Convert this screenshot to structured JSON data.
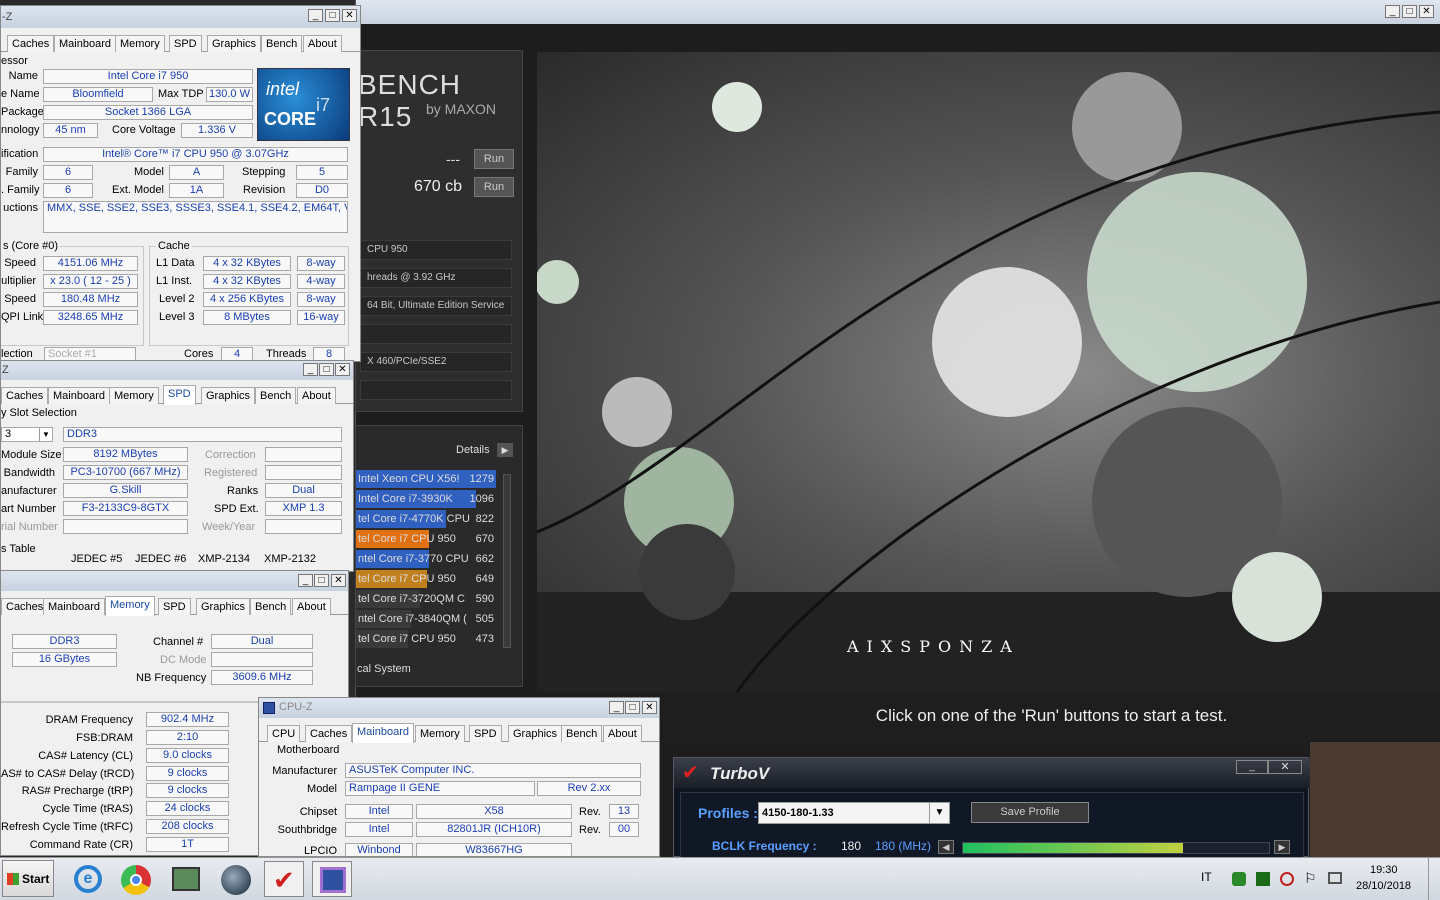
{
  "cinebench": {
    "title_main": "BENCH R15",
    "title_sub": "by MAXON",
    "opengl_score": "---",
    "cpu_score": "670 cb",
    "run_label": "Run",
    "processor": "CPU 950",
    "cores": "hreads @ 3.92 GHz",
    "os": "64 Bit, Ultimate Edition Service",
    "gfx": "X 460/PCIe/SSE2",
    "details_label": "Details",
    "status": "Click on one of the 'Run' buttons to start a test.",
    "local_system": "cal System",
    "aixsponza": "AIXSPONZA",
    "ranking": [
      {
        "name": "Intel Xeon CPU X56!",
        "score": "1279",
        "color": "#3060c0",
        "fill": 1.0
      },
      {
        "name": "Intel Core i7-3930K",
        "score": "1096",
        "color": "#3060c0",
        "fill": 0.857
      },
      {
        "name": "tel Core i7-4770K CPU",
        "score": "822",
        "color": "#3060c0",
        "fill": 0.643
      },
      {
        "name": "tel Core i7 CPU 950",
        "score": "670",
        "color": "#e07010",
        "fill": 0.524
      },
      {
        "name": "ntel Core i7-3770 CPU",
        "score": "662",
        "color": "#3060c0",
        "fill": 0.518
      },
      {
        "name": "tel Core i7 CPU 950",
        "score": "649",
        "color": "#c08020",
        "fill": 0.507
      },
      {
        "name": "tel Core i7-3720QM C",
        "score": "590",
        "color": "#3a3a3a",
        "fill": 0.46
      },
      {
        "name": "ntel Core i7-3840QM (",
        "score": "505",
        "color": "#3a3a3a",
        "fill": 0.395
      },
      {
        "name": "tel Core i7 CPU 950",
        "score": "473",
        "color": "#3a3a3a",
        "fill": 0.37
      }
    ]
  },
  "cpuz_cpu": {
    "title": "-Z",
    "tabs": [
      "Caches",
      "Mainboard",
      "Memory",
      "SPD",
      "Graphics",
      "Bench",
      "About"
    ],
    "group": "essor",
    "name_lbl": "Name",
    "name": "Intel Core i7 950",
    "code_lbl": "e Name",
    "code": "Bloomfield",
    "tdp_lbl": "Max TDP",
    "tdp": "130.0 W",
    "pkg_lbl": "Package",
    "pkg": "Socket 1366 LGA",
    "tech_lbl": "nnology",
    "tech": "45 nm",
    "volt_lbl": "Core Voltage",
    "volt": "1.336 V",
    "spec_lbl": "ification",
    "spec": "Intel® Core™ i7 CPU        950  @ 3.07GHz",
    "fam_lbl": "Family",
    "fam": "6",
    "model_lbl": "Model",
    "model": "A",
    "step_lbl": "Stepping",
    "step": "5",
    "efam_lbl": ". Family",
    "efam": "6",
    "emodel_lbl": "Ext. Model",
    "emodel": "1A",
    "rev_lbl": "Revision",
    "rev": "D0",
    "instr_lbl": "uctions",
    "instr": "MMX, SSE, SSE2, SSE3, SSSE3, SSE4.1, SSE4.2, EM64T, VT-x",
    "clocks_grp": "s (Core #0)",
    "cspeed_lbl": "Speed",
    "cspeed": "4151.06 MHz",
    "mult_lbl": "ultiplier",
    "mult": "x 23.0 ( 12 - 25 )",
    "bspeed_lbl": "Speed",
    "bspeed": "180.48 MHz",
    "qpi_lbl": "QPI Link",
    "qpi": "3248.65 MHz",
    "cache_grp": "Cache",
    "l1d_lbl": "L1 Data",
    "l1d": "4 x 32 KBytes",
    "l1d_w": "8-way",
    "l1i_lbl": "L1 Inst.",
    "l1i": "4 x 32 KBytes",
    "l1i_w": "4-way",
    "l2_lbl": "Level 2",
    "l2": "4 x 256 KBytes",
    "l2_w": "8-way",
    "l3_lbl": "Level 3",
    "l3": "8 MBytes",
    "l3_w": "16-way",
    "sel_lbl": "lection",
    "sel": "Socket #1",
    "cores_lbl": "Cores",
    "cores": "4",
    "threads_lbl": "Threads",
    "threads": "8"
  },
  "cpuz_spd": {
    "title": "Z",
    "tabs": [
      "Caches",
      "Mainboard",
      "Memory",
      "SPD",
      "Graphics",
      "Bench",
      "About"
    ],
    "slot_grp": "y Slot Selection",
    "slot": "3",
    "type": "DDR3",
    "msize_lbl": "Module Size",
    "msize": "8192 MBytes",
    "corr_lbl": "Correction",
    "bw_lbl": "Bandwidth",
    "bw": "PC3-10700 (667 MHz)",
    "reg_lbl": "Registered",
    "manu_lbl": "anufacturer",
    "manu": "G.Skill",
    "ranks_lbl": "Ranks",
    "ranks": "Dual",
    "part_lbl": "art Number",
    "part": "F3-2133C9-8GTX",
    "spdext_lbl": "SPD Ext.",
    "spdext": "XMP 1.3",
    "serial_lbl": "rial Number",
    "week_lbl": "Week/Year",
    "timings_grp": "s Table",
    "t_cols": [
      "JEDEC #5",
      "JEDEC #6",
      "XMP-2134",
      "XMP-2132"
    ]
  },
  "cpuz_mem": {
    "tabs": [
      "Caches",
      "Mainboard",
      "Memory",
      "SPD",
      "Graphics",
      "Bench",
      "About"
    ],
    "type": "DDR3",
    "size": "16 GBytes",
    "chan_lbl": "Channel #",
    "chan": "Dual",
    "dc_lbl": "DC Mode",
    "nb_lbl": "NB Frequency",
    "nb": "3609.6 MHz",
    "dram_lbl": "DRAM Frequency",
    "dram": "902.4 MHz",
    "fsb_lbl": "FSB:DRAM",
    "fsb": "2:10",
    "cl_lbl": "CAS# Latency (CL)",
    "cl": "9.0 clocks",
    "rcd_lbl": "AS# to CAS# Delay (tRCD)",
    "rcd": "9 clocks",
    "rp_lbl": "RAS# Precharge (tRP)",
    "rp": "9 clocks",
    "ras_lbl": "Cycle Time (tRAS)",
    "ras": "24 clocks",
    "rfc_lbl": "Refresh Cycle Time (tRFC)",
    "rfc": "208 clocks",
    "cr_lbl": "Command Rate (CR)",
    "cr": "1T"
  },
  "cpuz_mb": {
    "title": "CPU-Z",
    "tabs": [
      "CPU",
      "Caches",
      "Mainboard",
      "Memory",
      "SPD",
      "Graphics",
      "Bench",
      "About"
    ],
    "grp": "Motherboard",
    "manu_lbl": "Manufacturer",
    "manu": "ASUSTeK Computer INC.",
    "model_lbl": "Model",
    "model": "Rampage II GENE",
    "model_rev": "Rev 2.xx",
    "chipset_lbl": "Chipset",
    "chipset_v": "Intel",
    "chipset": "X58",
    "rev_lbl": "Rev.",
    "chipset_rev": "13",
    "south_lbl": "Southbridge",
    "south_v": "Intel",
    "south": "82801JR (ICH10R)",
    "south_rev": "00",
    "lpcio_lbl": "LPCIO",
    "lpcio_v": "Winbond",
    "lpcio": "W83667HG"
  },
  "turbov": {
    "title": "TurboV",
    "profiles_lbl": "Profiles :",
    "profile": "4150-180-1.33",
    "save": "Save Profile",
    "bclk_lbl": "BCLK Frequency :",
    "bclk_val": "180",
    "bclk_set": "180 (MHz)",
    "slider_fill": 0.72
  },
  "taskbar": {
    "start": "Start",
    "lang": "IT",
    "time": "19:30",
    "date": "28/10/2018"
  },
  "colors": {
    "cpuz_value": "#1a3fb0",
    "turbov_blue": "#5aa0ff",
    "tab_selected": "#1a4aa0"
  }
}
